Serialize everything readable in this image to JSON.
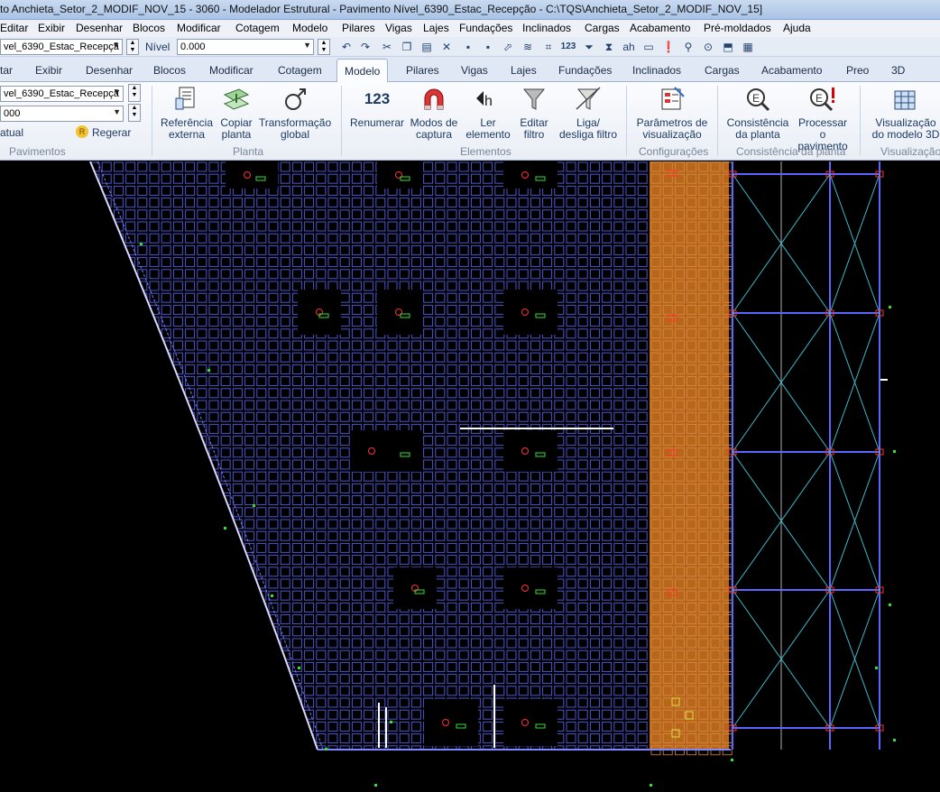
{
  "window": {
    "title": "to Anchieta_Setor_2_MODIF_NOV_15 - 3060 - Modelador Estrutural - Pavimento Nível_6390_Estac_Recepção - C:\\TQS\\Anchieta_Setor_2_MODIF_NOV_15]"
  },
  "menu": [
    "Editar",
    "Exibir",
    "Desenhar",
    "Blocos",
    "Modificar",
    "Cotagem",
    "Modelo",
    "Pilares",
    "Vigas",
    "Lajes",
    "Fundações",
    "Inclinados",
    "Cargas",
    "Acabamento",
    "Pré-moldados",
    "Ajuda"
  ],
  "qat": {
    "floor_combo": "vel_6390_Estac_Recepçã",
    "level_label": "Nível",
    "level_value": "0.000",
    "icons": [
      "undo-icon",
      "redo-icon",
      "cut-icon",
      "copy-icon",
      "paste-icon",
      "delete-icon",
      "save-icon",
      "save-as-icon",
      "select-icon",
      "layers-icon",
      "renumber-icon",
      "filter-icon",
      "toggle-filter-icon",
      "read-element-icon",
      "beam-icon",
      "column-icon",
      "error-icon",
      "zoom-icon",
      "consistency-icon",
      "view-icon",
      "model3d-icon"
    ],
    "renumber_text": "123"
  },
  "tabs": [
    "tar",
    "Exibir",
    "Desenhar",
    "Blocos",
    "Modificar",
    "Cotagem",
    "Modelo",
    "Pilares",
    "Vigas",
    "Lajes",
    "Fundações",
    "Inclinados",
    "Cargas",
    "Acabamento",
    "Preo",
    "3D"
  ],
  "active_tab": "Modelo",
  "ribbon": {
    "pavimentos": {
      "combo_floor": "vel_6390_Estac_Recepçã",
      "combo_level": "000",
      "atual_label": "atual",
      "regerar_label": "Regerar",
      "group_label": "Pavimentos"
    },
    "planta": {
      "buttons": [
        {
          "l1": "Referência",
          "l2": "externa"
        },
        {
          "l1": "Copiar",
          "l2": "planta"
        },
        {
          "l1": "Transformação",
          "l2": "global"
        }
      ],
      "group_label": "Planta"
    },
    "elementos": {
      "renumber_text": "123",
      "buttons": [
        {
          "l1": "Renumerar",
          "l2": ""
        },
        {
          "l1": "Modos de",
          "l2": "captura"
        },
        {
          "l1": "Ler",
          "l2": "elemento"
        },
        {
          "l1": "Editar",
          "l2": "filtro"
        },
        {
          "l1": "Liga/",
          "l2": "desliga filtro"
        }
      ],
      "group_label": "Elementos"
    },
    "configuracoes": {
      "buttons": [
        {
          "l1": "Parâmetros de",
          "l2": "visualização"
        }
      ],
      "group_label": "Configurações"
    },
    "consistencia": {
      "buttons": [
        {
          "l1": "Consistência",
          "l2": "da planta"
        },
        {
          "l1": "Processar o",
          "l2": "pavimento"
        }
      ],
      "group_label": "Consistência da planta"
    },
    "visualizacao": {
      "buttons": [
        {
          "l1": "Visualização",
          "l2": "do modelo 3D"
        }
      ],
      "group_label": "Visualização"
    }
  },
  "drawing": {
    "background": "#000000",
    "waffle_color": "#4d55c8",
    "ramp_color": "#b8671a",
    "frame_color": "#5a66ff",
    "brace_color": "#3fb8c8",
    "accent_red": "#ff3030",
    "accent_green": "#33e033",
    "accent_white": "#ffffff",
    "accent_yellow": "#e0e040"
  }
}
